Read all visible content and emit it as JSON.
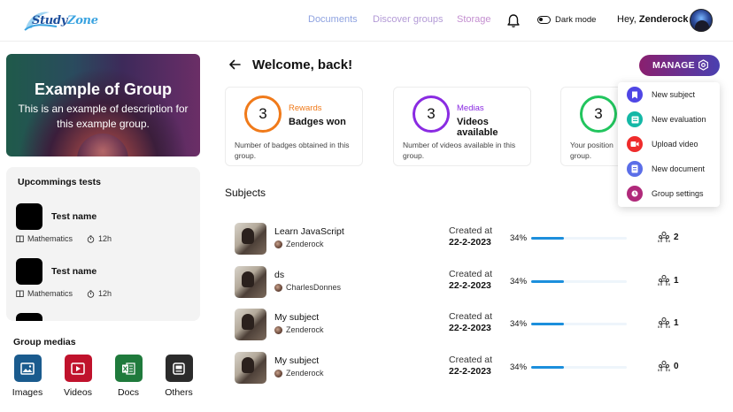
{
  "header": {
    "logo_text_a": "Study",
    "logo_text_b": "Zone",
    "nav": [
      "Documents",
      "Discover groups",
      "Storage"
    ],
    "dark_mode_label": "Dark mode",
    "greeting_prefix": "Hey, ",
    "username": "Zenderock"
  },
  "group": {
    "title": "Example of Group",
    "description": "This is an example of description for this example group."
  },
  "tests": {
    "title": "Upcommings tests",
    "items": [
      {
        "name": "Test name",
        "subject": "Mathematics",
        "duration": "12h"
      },
      {
        "name": "Test name",
        "subject": "Mathematics",
        "duration": "12h"
      }
    ]
  },
  "medias": {
    "title": "Group medias",
    "items": [
      {
        "label": "Images",
        "color": "#1a5b8e",
        "icon": "image-icon"
      },
      {
        "label": "Videos",
        "color": "#c0122c",
        "icon": "play-icon"
      },
      {
        "label": "Docs",
        "color": "#1f7a3c",
        "icon": "excel-icon"
      },
      {
        "label": "Others",
        "color": "#2b2b2b",
        "icon": "folder-icon"
      }
    ]
  },
  "main": {
    "welcome": "Welcome, back!",
    "manage_label": "MANAGE",
    "stats": [
      {
        "value": "3",
        "kicker": "Rewards",
        "main": "Badges won",
        "desc": "Number of badges obtained in this group.",
        "color": "#f07a1a"
      },
      {
        "value": "3",
        "kicker": "Medias",
        "main": "Videos available",
        "desc": "Number of videos available in this group.",
        "color": "#8a2be2"
      },
      {
        "value": "3",
        "kicker": "",
        "main": "",
        "desc": "Your position group.",
        "color": "#22c55e"
      }
    ],
    "subjects_title": "Subjects",
    "subjects": [
      {
        "name": "Learn JavaScript",
        "owner": "Zenderock",
        "created_label": "Created at",
        "date": "22-2-2023",
        "percent": "34%",
        "progress": 0.34,
        "members": "2"
      },
      {
        "name": "ds",
        "owner": "CharlesDonnes",
        "created_label": "Created at",
        "date": "22-2-2023",
        "percent": "34%",
        "progress": 0.34,
        "members": "1"
      },
      {
        "name": "My subject",
        "owner": "Zenderock",
        "created_label": "Created at",
        "date": "22-2-2023",
        "percent": "34%",
        "progress": 0.34,
        "members": "1"
      },
      {
        "name": "My subject",
        "owner": "Zenderock",
        "created_label": "Created at",
        "date": "22-2-2023",
        "percent": "34%",
        "progress": 0.34,
        "members": "0"
      }
    ]
  },
  "dropdown": {
    "items": [
      {
        "label": "New subject",
        "color": "#4f46e5",
        "icon": "bookmark-icon"
      },
      {
        "label": "New evaluation",
        "color": "#14b8a6",
        "icon": "list-icon"
      },
      {
        "label": "Upload video",
        "color": "#ef2b2b",
        "icon": "video-icon"
      },
      {
        "label": "New document",
        "color": "#5b6ee8",
        "icon": "document-icon"
      },
      {
        "label": "Group settings",
        "color": "#b0297a",
        "icon": "settings-icon"
      }
    ]
  }
}
